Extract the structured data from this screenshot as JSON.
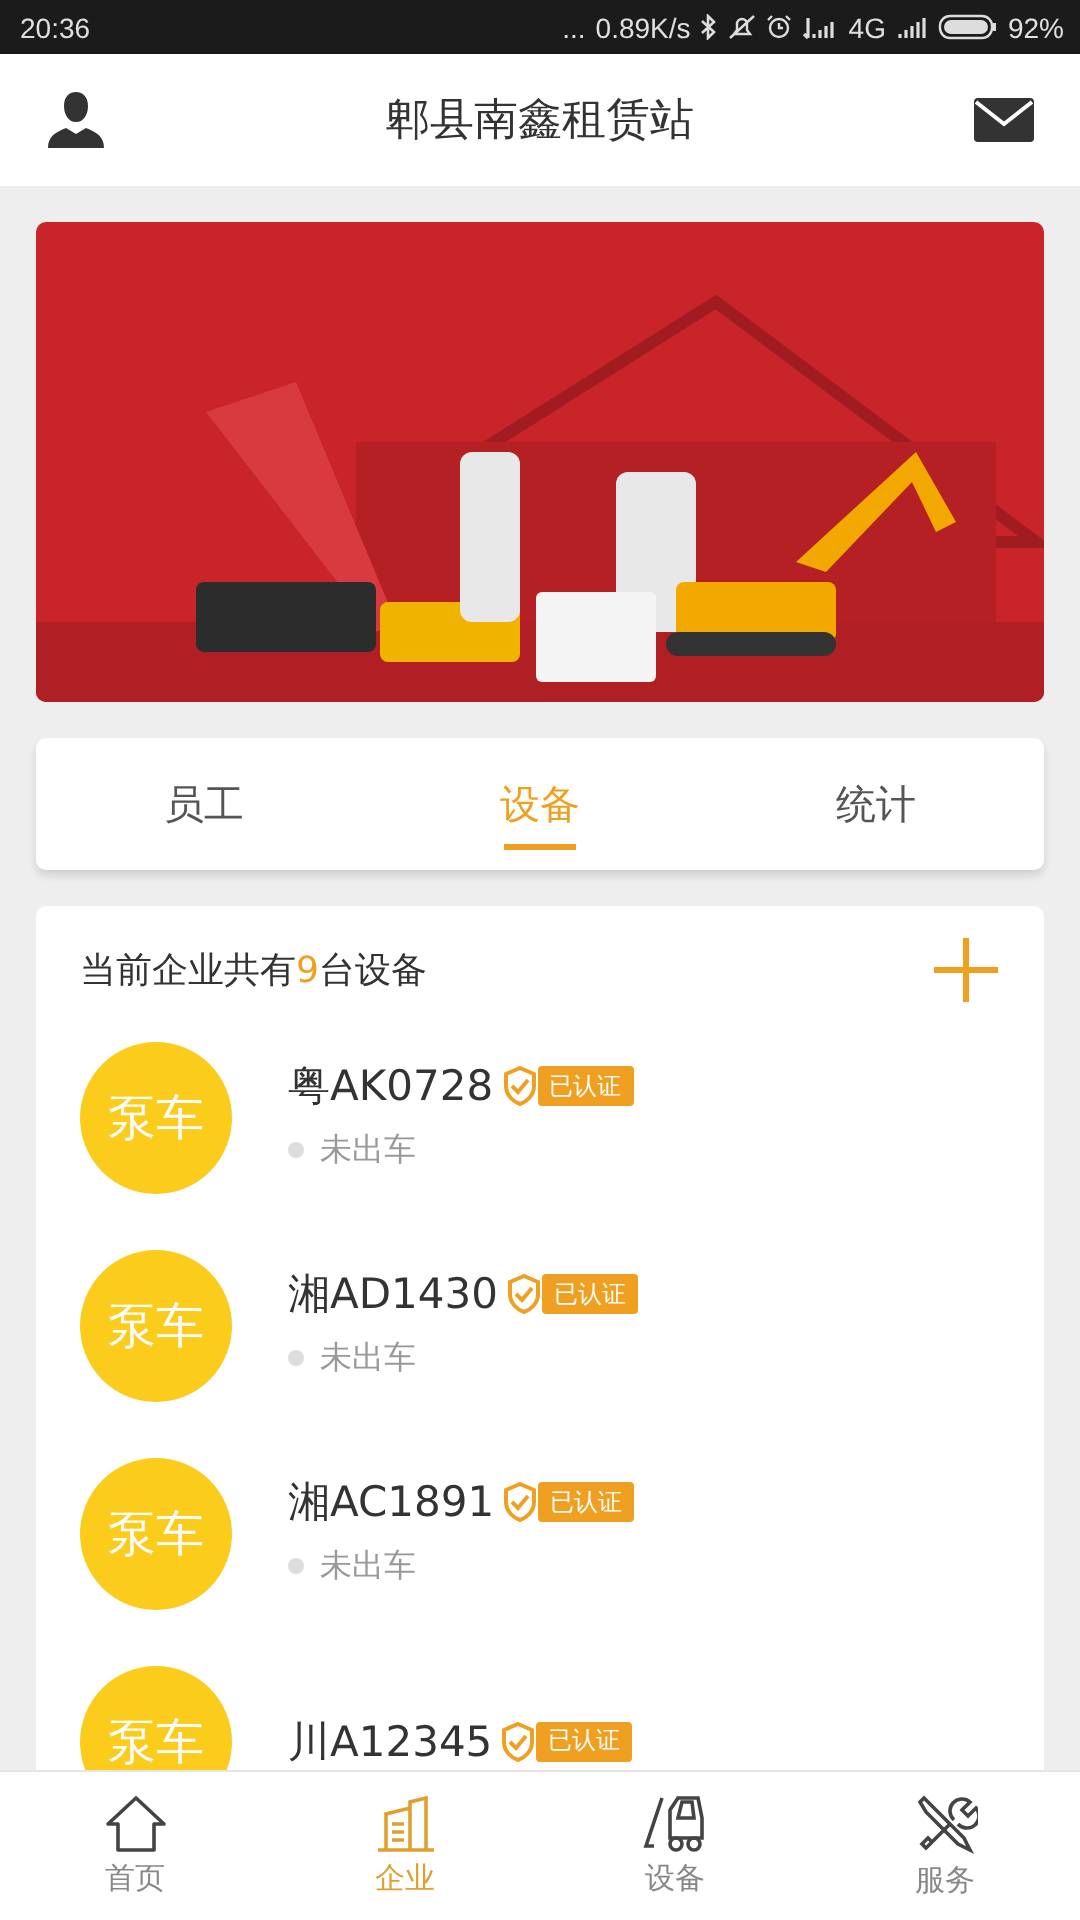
{
  "status_bar": {
    "time": "20:36",
    "dots": "...",
    "speed": "0.89K/s",
    "network": "4G",
    "battery_text": "92%"
  },
  "header": {
    "title": "郫县南鑫租赁站"
  },
  "tabs": [
    {
      "label": "员工",
      "selected": false
    },
    {
      "label": "设备",
      "selected": true
    },
    {
      "label": "统计",
      "selected": false
    }
  ],
  "summary": {
    "prefix": "当前企业共有",
    "count": "9",
    "suffix": "台设备"
  },
  "devices": [
    {
      "avatar": "泵车",
      "plate": "粤AK0728",
      "badge": "已认证",
      "status": "未出车"
    },
    {
      "avatar": "泵车",
      "plate": "湘AD1430",
      "badge": "已认证",
      "status": "未出车"
    },
    {
      "avatar": "泵车",
      "plate": "湘AC1891",
      "badge": "已认证",
      "status": "未出车"
    },
    {
      "avatar": "泵车",
      "plate": "川A12345",
      "badge": "已认证"
    }
  ],
  "bottom_nav": [
    {
      "label": "首页",
      "kind": "home",
      "selected": false
    },
    {
      "label": "企业",
      "kind": "building",
      "selected": true
    },
    {
      "label": "设备",
      "kind": "forklift",
      "selected": false
    },
    {
      "label": "服务",
      "kind": "tools",
      "selected": false
    }
  ]
}
